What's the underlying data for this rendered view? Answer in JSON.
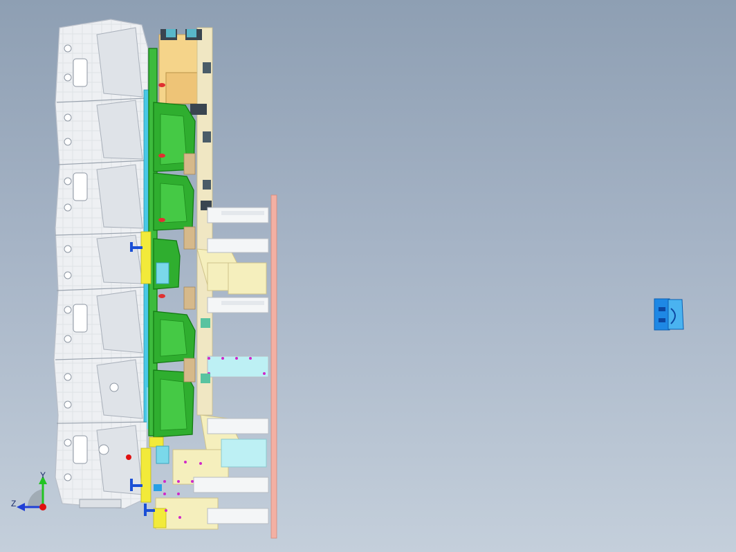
{
  "viewport": {
    "background_top": "#8e9fb3",
    "background_bottom": "#c4cfdb"
  },
  "triad": {
    "x_label": "",
    "y_label": "Y",
    "z_label": "Z",
    "y_color": "#22c422",
    "z_color": "#1f3fd6",
    "origin_color": "#e01010"
  },
  "colors": {
    "die_white": "#eef0f3",
    "die_shadow": "#c9ced6",
    "green_part": "#2fae2f",
    "green_dark": "#137a13",
    "yellow": "#f2ea3a",
    "pale_yellow": "#f5efbd",
    "light_orange": "#f5d48a",
    "tan": "#d6b98a",
    "cyan": "#48c8e6",
    "light_cyan": "#bdf0f4",
    "salmon": "#f3b0a3",
    "blue": "#1565d8",
    "magenta": "#d028c8",
    "white_post": "#f4f6f7"
  },
  "small_part": {
    "icon": "blue-bracket-part",
    "color": "#1e88e5"
  }
}
